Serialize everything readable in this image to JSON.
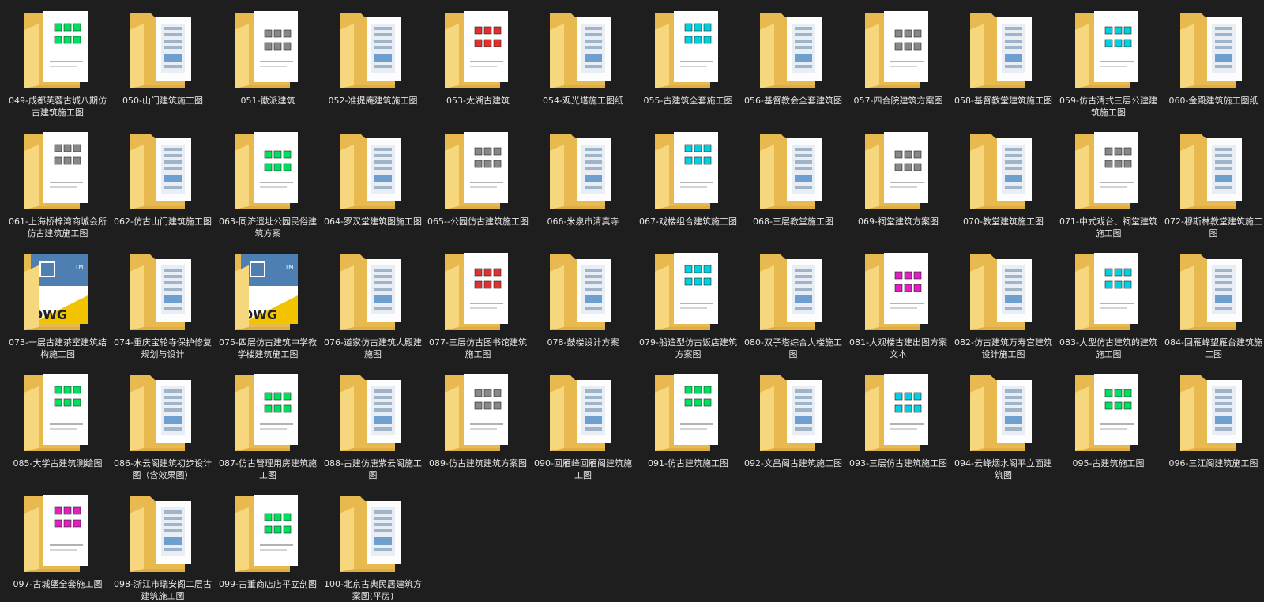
{
  "folder_icon": "folder-icon",
  "colors": {
    "background": "#1e1e1e",
    "folder_back": "#e8b94e",
    "folder_front": "#f7d77e",
    "paper": "#ffffff",
    "label": "#e6e6e6"
  },
  "items": [
    {
      "name": "049-成都芙蓉古城八期仿古建筑施工图",
      "thumb": "plan-green"
    },
    {
      "name": "050-山门建筑施工图",
      "thumb": "doc"
    },
    {
      "name": "051-徽派建筑",
      "thumb": "plan-bw"
    },
    {
      "name": "052-准提庵建筑施工图",
      "thumb": "doc"
    },
    {
      "name": "053-太湖古建筑",
      "thumb": "plan-red"
    },
    {
      "name": "054-观光塔施工图纸",
      "thumb": "doc"
    },
    {
      "name": "055-古建筑全套施工图",
      "thumb": "plan-cyan"
    },
    {
      "name": "056-基督教会全套建筑图",
      "thumb": "doc"
    },
    {
      "name": "057-四合院建筑方案图",
      "thumb": "plan-bw"
    },
    {
      "name": "058-基督教堂建筑施工图",
      "thumb": "doc"
    },
    {
      "name": "059-仿古清式三层公建建筑施工图",
      "thumb": "plan-cyan"
    },
    {
      "name": "060-金殿建筑施工图纸",
      "thumb": "doc"
    },
    {
      "name": "061-上海桥梓湾商城会所仿古建筑施工图",
      "thumb": "plan-bw"
    },
    {
      "name": "062-仿古山门建筑施工图",
      "thumb": "doc"
    },
    {
      "name": "063-同济遗址公园民俗建筑方案",
      "thumb": "plan-green"
    },
    {
      "name": "064-罗汉堂建筑图施工图",
      "thumb": "doc"
    },
    {
      "name": "065--公园仿古建筑施工图",
      "thumb": "plan-bw"
    },
    {
      "name": "066-米泉市清真寺",
      "thumb": "doc"
    },
    {
      "name": "067-戏楼组合建筑施工图",
      "thumb": "plan-cyan"
    },
    {
      "name": "068-三层教堂施工图",
      "thumb": "doc"
    },
    {
      "name": "069-祠堂建筑方案图",
      "thumb": "plan-bw"
    },
    {
      "name": "070-教堂建筑施工图",
      "thumb": "doc"
    },
    {
      "name": "071-中式戏台、祠堂建筑施工图",
      "thumb": "plan-bw"
    },
    {
      "name": "072-穆斯林教堂建筑施工图",
      "thumb": "doc"
    },
    {
      "name": "073-一层古建茶室建筑结构施工图",
      "thumb": "dwg"
    },
    {
      "name": "074-重庆宝轮寺保护修复规划与设计",
      "thumb": "doc"
    },
    {
      "name": "075-四层仿古建筑中学教学楼建筑施工图",
      "thumb": "dwg"
    },
    {
      "name": "076-道家仿古建筑大殿建施图",
      "thumb": "doc"
    },
    {
      "name": "077-三层仿古图书馆建筑施工图",
      "thumb": "plan-red"
    },
    {
      "name": "078-鼓楼设计方案",
      "thumb": "doc"
    },
    {
      "name": "079-船造型仿古饭店建筑方案图",
      "thumb": "plan-cyan"
    },
    {
      "name": "080-双子塔综合大楼施工图",
      "thumb": "doc"
    },
    {
      "name": "081-大观楼古建出图方案文本",
      "thumb": "plan-magenta"
    },
    {
      "name": "082-仿古建筑万寿宫建筑设计施工图",
      "thumb": "doc"
    },
    {
      "name": "083-大型仿古建筑的建筑施工图",
      "thumb": "plan-cyan"
    },
    {
      "name": "084-回雁峰望雁台建筑施工图",
      "thumb": "doc"
    },
    {
      "name": "085-大学古建筑测绘图",
      "thumb": "plan-green"
    },
    {
      "name": "086-水云阁建筑初步设计图（含效果图）",
      "thumb": "doc"
    },
    {
      "name": "087-仿古管理用房建筑施工图",
      "thumb": "plan-green"
    },
    {
      "name": "088-古建仿唐紫云阁施工图",
      "thumb": "doc"
    },
    {
      "name": "089-仿古建筑建筑方案图",
      "thumb": "plan-bw"
    },
    {
      "name": "090-回雁峰回雁阁建筑施工图",
      "thumb": "doc"
    },
    {
      "name": "091-仿古建筑施工图",
      "thumb": "plan-green"
    },
    {
      "name": "092-文昌阁古建筑施工图",
      "thumb": "doc"
    },
    {
      "name": "093-三层仿古建筑施工图",
      "thumb": "plan-cyan"
    },
    {
      "name": "094-云峰烟水阁平立面建筑图",
      "thumb": "doc"
    },
    {
      "name": "095-古建筑施工图",
      "thumb": "plan-green"
    },
    {
      "name": "096-三江阁建筑施工图",
      "thumb": "doc"
    },
    {
      "name": "097-古城堡全套施工图",
      "thumb": "plan-magenta"
    },
    {
      "name": "098-浙江市瑞安阁二层古建筑施工图",
      "thumb": "doc"
    },
    {
      "name": "099-古董商店店平立剖图",
      "thumb": "plan-green"
    },
    {
      "name": "100-北京古典民居建筑方案图(平房)",
      "thumb": "doc"
    }
  ]
}
